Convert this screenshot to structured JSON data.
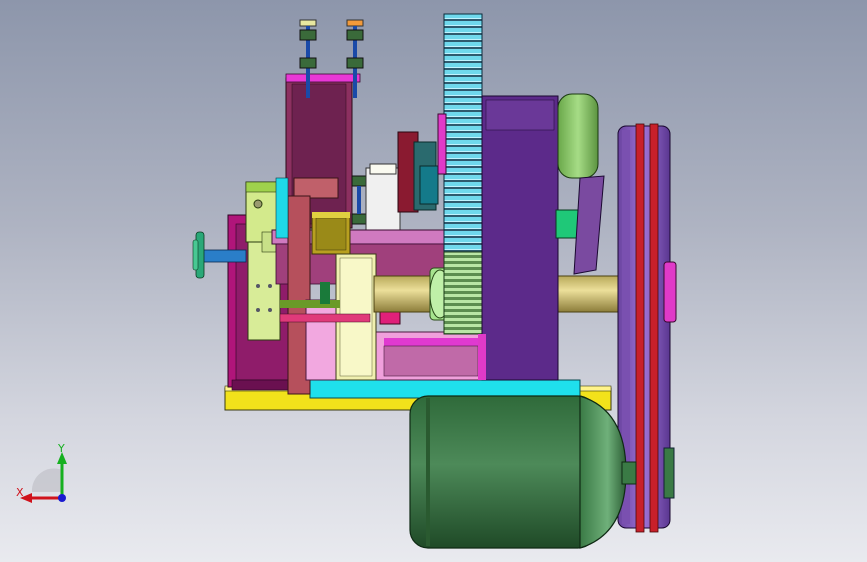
{
  "viewport": {
    "background_top": "#8d96ab",
    "background_bottom": "#e9eaef"
  },
  "triad": {
    "x_label": "X",
    "y_label": "Y",
    "x_color": "#d0121c",
    "y_color": "#16b020",
    "z_color": "#1a1ad0"
  },
  "model": {
    "gear_color": "#5fd3e8",
    "motor_color": "#3f7f4c",
    "pulley_color": "#8f60c4",
    "belt_color": "#c8202a",
    "housing_color": "#5c2a8a",
    "base_color": "#f2e21b"
  }
}
